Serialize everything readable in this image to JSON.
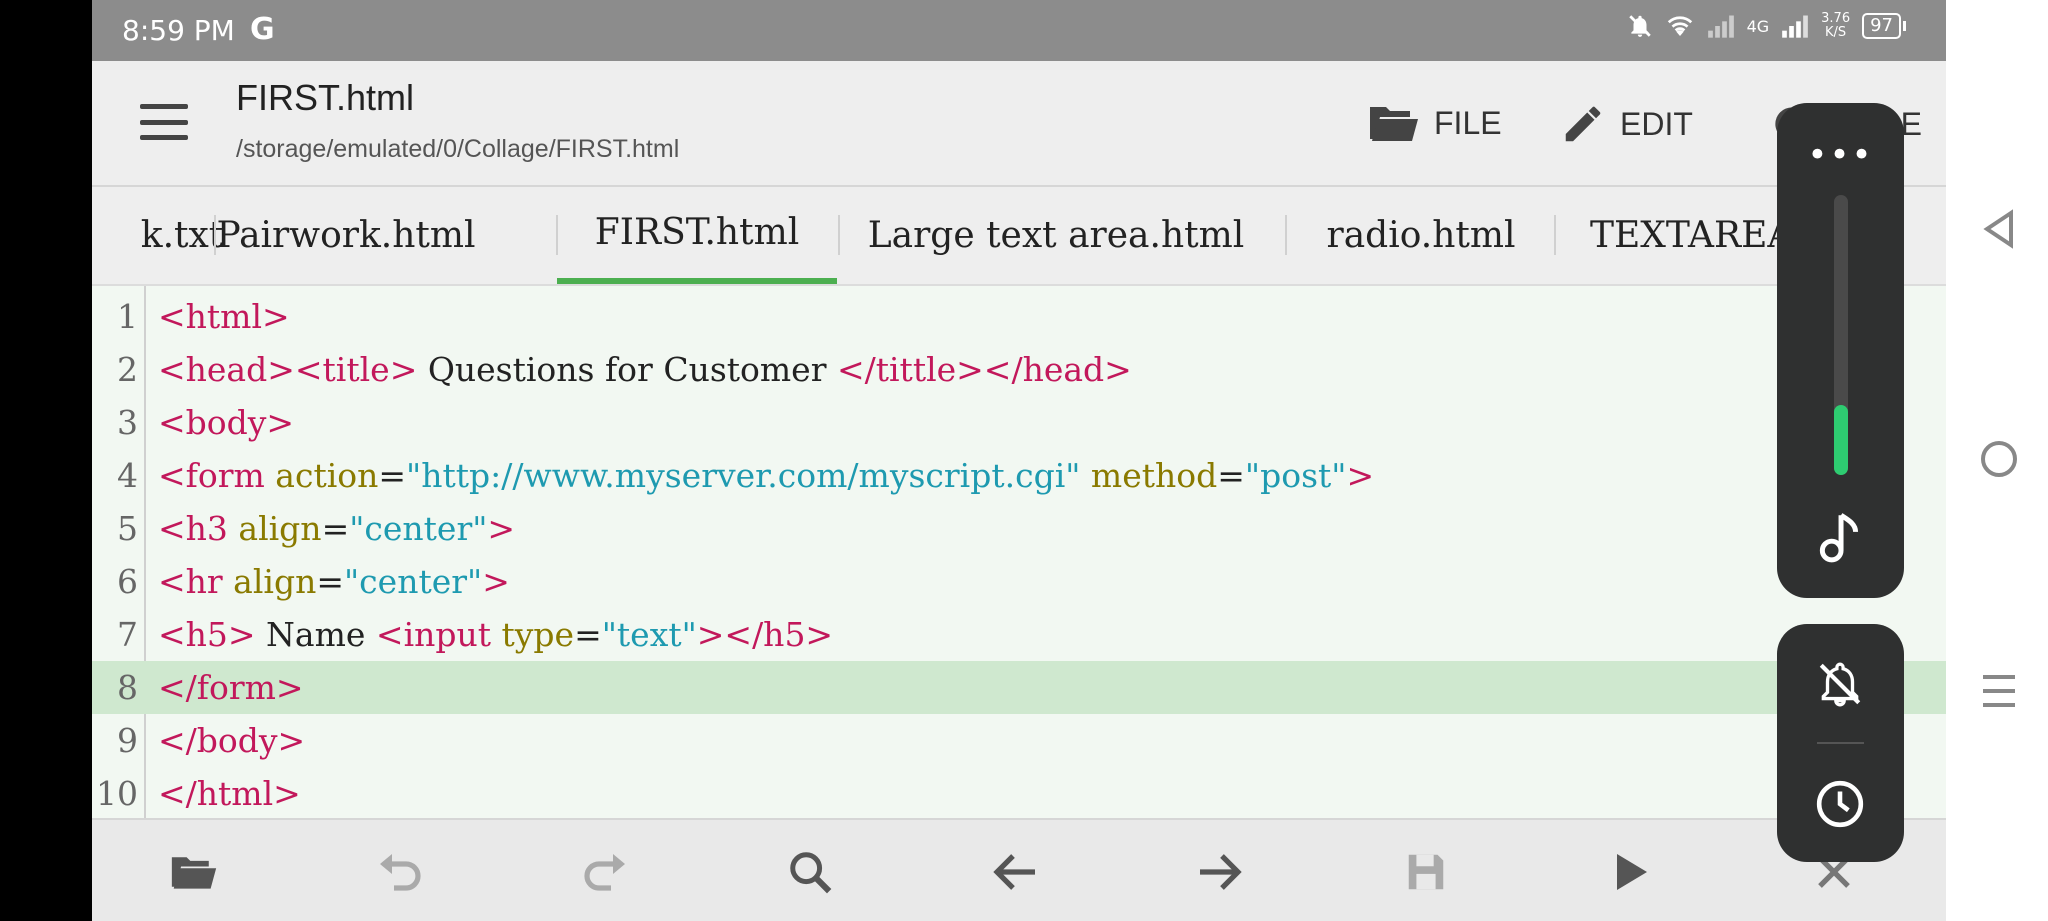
{
  "status": {
    "time": "8:59 PM",
    "g_logo": "G",
    "network": "4G",
    "speed_value": "3.76",
    "speed_unit": "K/S",
    "battery": "97"
  },
  "appbar": {
    "title": "FIRST.html",
    "path": "/storage/emulated/0/Collage/FIRST.html",
    "file_label": "FILE",
    "edit_label": "EDIT",
    "more_label": "MORE"
  },
  "tabs": [
    {
      "label": "k.txt"
    },
    {
      "label": "Pairwork.html"
    },
    {
      "label": "FIRST.html",
      "active": true
    },
    {
      "label": "Large text area.html"
    },
    {
      "label": "radio.html"
    },
    {
      "label": "TEXTAREA"
    }
  ],
  "editor": {
    "highlighted_line": 8,
    "line_numbers": [
      "1",
      "2",
      "3",
      "4",
      "5",
      "6",
      "7",
      "8",
      "9",
      "10"
    ],
    "code": {
      "l1": [
        "<html>"
      ],
      "l2": [
        "<head><title>",
        " Questions for Customer ",
        "</tittle></head>"
      ],
      "l3": [
        "<body>"
      ],
      "l4": [
        "<form ",
        "action",
        "=",
        "\"http://www.myserver.com/myscript.cgi\"",
        " method",
        "=",
        "\"post\"",
        ">"
      ],
      "l5": [
        "<h3 ",
        "align",
        "=",
        "\"center\"",
        ">"
      ],
      "l6": [
        "<hr ",
        "align",
        "=",
        "\"center\"",
        ">"
      ],
      "l7": [
        "<h5>",
        " Name ",
        "<input ",
        "type",
        "=",
        "\"text\"",
        "></h5>"
      ],
      "l8": [
        "</form>"
      ],
      "l9": [
        "</body>"
      ],
      "l10": [
        "</html>"
      ]
    }
  },
  "colors": {
    "tag": "#c2185b",
    "attribute": "#8a7a00",
    "string": "#1e9ab0",
    "active_tab_indicator": "#4caf50",
    "slider_fill": "#2ecc71"
  },
  "overlay": {
    "volume_level": 0.25
  },
  "icons": {
    "bottom": [
      "folder-open-icon",
      "undo-icon",
      "redo-icon",
      "search-icon",
      "arrow-left-icon",
      "arrow-right-icon",
      "save-icon",
      "play-icon",
      "close-icon"
    ],
    "nav": [
      "back-triangle-icon",
      "home-circle-icon",
      "menu-lines-icon"
    ]
  }
}
